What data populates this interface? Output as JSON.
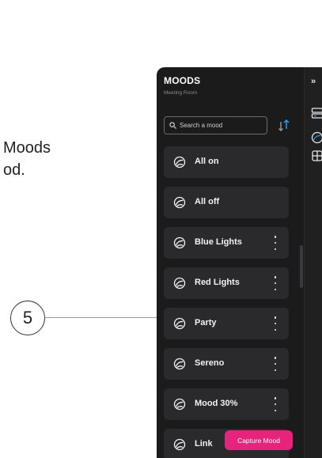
{
  "doc": {
    "line1": "Moods",
    "line2": "od."
  },
  "callout": {
    "number": "5"
  },
  "panel": {
    "title": "MOODS",
    "subtitle": "Meeting Room",
    "search": {
      "placeholder": "Search a mood",
      "value": ""
    },
    "sort_icon": "sort-arrows-icon",
    "moods": [
      {
        "label": "All on",
        "has_menu": false
      },
      {
        "label": "All off",
        "has_menu": false
      },
      {
        "label": "Blue Lights",
        "has_menu": true
      },
      {
        "label": "Red Lights",
        "has_menu": true
      },
      {
        "label": "Party",
        "has_menu": true
      },
      {
        "label": "Sereno",
        "has_menu": true
      },
      {
        "label": "Mood 30%",
        "has_menu": true
      },
      {
        "label": "Link",
        "has_menu": true
      }
    ],
    "capture_button": "Capture Mood"
  },
  "rail": {
    "collapse_label": "»",
    "icons": [
      "devices-icon",
      "moods-icon",
      "layout-icon"
    ]
  },
  "colors": {
    "panel_bg": "#1b1b1c",
    "item_bg": "#2a2a2c",
    "accent_pink": "#e6247d",
    "accent_blue": "#2f8fe6"
  }
}
